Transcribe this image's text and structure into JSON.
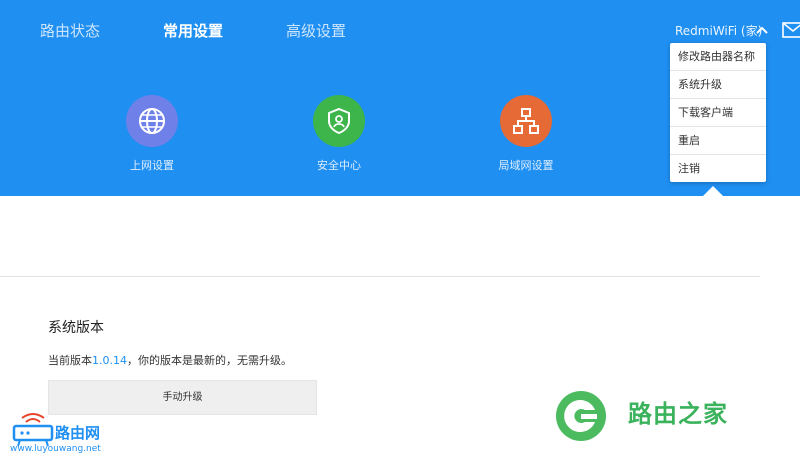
{
  "nav": {
    "items": [
      {
        "label": "路由状态"
      },
      {
        "label": "常用设置"
      },
      {
        "label": "高级设置"
      }
    ],
    "router_name": "RedmiWiFi (家)"
  },
  "shortcuts": [
    {
      "label": "上网设置",
      "color": "#6f80e8",
      "icon": "globe-icon"
    },
    {
      "label": "安全中心",
      "color": "#3db54a",
      "icon": "shield-user-icon"
    },
    {
      "label": "局域网设置",
      "color": "#e56a35",
      "icon": "network-icon"
    }
  ],
  "dropdown": {
    "items": [
      "修改路由器名称",
      "系统升级",
      "下载客户端",
      "重启",
      "注销"
    ]
  },
  "system": {
    "title": "系统版本",
    "version_prefix": "当前版本",
    "version": "1.0.14",
    "version_suffix": "，你的版本是最新的，无需升级。",
    "manual_button": "手动升级"
  },
  "watermarks": {
    "left_text": "路由网",
    "left_url": "www.luyouwang.net",
    "right_text": "路由之家"
  },
  "colors": {
    "header": "#1f8ff2",
    "accent": "#1f8ff2"
  }
}
